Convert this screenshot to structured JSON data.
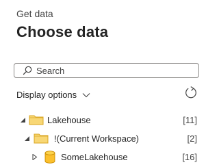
{
  "header": {
    "subtitle": "Get data",
    "title": "Choose data"
  },
  "search": {
    "placeholder": "Search",
    "value": ""
  },
  "display_options": {
    "label": "Display options"
  },
  "tree": [
    {
      "label": "Lakehouse",
      "count": "[11]",
      "expanded": true,
      "icon": "folder-icon"
    },
    {
      "label": "!(Current Workspace)",
      "count": "[2]",
      "expanded": true,
      "icon": "folder-icon"
    },
    {
      "label": "SomeLakehouse",
      "count": "[16]",
      "expanded": false,
      "icon": "database-icon"
    }
  ],
  "colors": {
    "folder_fill": "#f8d775",
    "folder_stroke": "#d9a520",
    "database_fill": "#fbc02d",
    "text": "#242424"
  }
}
